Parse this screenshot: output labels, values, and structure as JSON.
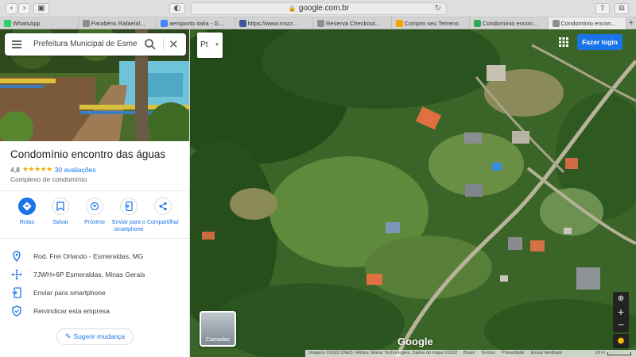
{
  "browser": {
    "url": "google.com.br",
    "tabs": [
      {
        "label": "WhatsApp",
        "color": "#25d366"
      },
      {
        "label": "Parabéns Rafaela!...",
        "color": "#8e8e8e"
      },
      {
        "label": "aeroporto italia - G...",
        "color": "#4285f4"
      },
      {
        "label": "https://www.mscr...",
        "color": "#3b5998"
      },
      {
        "label": "Reserva Checkout...",
        "color": "#8e8e8e"
      },
      {
        "label": "Compro seu Terreno",
        "color": "#f4a300"
      },
      {
        "label": "Condomínio encon...",
        "color": "#34a853"
      },
      {
        "label": "Condomínio encon...",
        "color": "#8e8e8e"
      }
    ]
  },
  "sidebar": {
    "search": {
      "value": "Prefeitura Municipal de Esmeraldas"
    },
    "place": {
      "title": "Condomínio encontro das águas",
      "rating": "4,8",
      "stars": "★★★★★",
      "reviews": "30 avaliações",
      "category": "Complexo de condomínio"
    },
    "actions": [
      {
        "label": "Rotas",
        "icon": "directions-icon"
      },
      {
        "label": "Salvar",
        "icon": "bookmark-icon"
      },
      {
        "label": "Próximo",
        "icon": "nearby-icon"
      },
      {
        "label": "Enviar para o smartphone",
        "icon": "send-to-phone-icon"
      },
      {
        "label": "Compartilhar",
        "icon": "share-icon"
      }
    ],
    "info": [
      {
        "text": "Rod. Frei Orlando - Esmeraldas, MG",
        "icon": "location-pin-icon"
      },
      {
        "text": "7JWH+6P Esmeraldas, Minas Gerais",
        "icon": "plus-code-icon"
      },
      {
        "text": "Enviar para smartphone",
        "icon": "phone-icon"
      },
      {
        "text": "Reivindicar esta empresa",
        "icon": "shield-icon"
      }
    ],
    "suggest_label": "Sugerir mudança"
  },
  "map": {
    "language_button": "Pt",
    "sign_in": "Fazer login",
    "layers_label": "Camadas",
    "logo": "Google",
    "attribution": "Imagens ©2022 CNES / Airbus, Maxar Technologies, Dados do mapa ©2022",
    "links": [
      "Brasil",
      "Termos",
      "Privacidade",
      "Enviar feedback"
    ],
    "scale": "20 m",
    "colors": {
      "accent": "#1a73e8",
      "star": "#f9ab00"
    }
  }
}
